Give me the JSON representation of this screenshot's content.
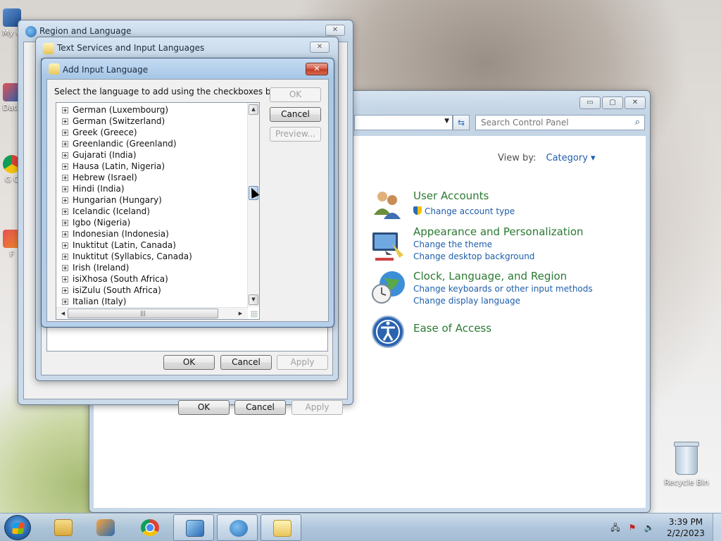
{
  "desktop": {
    "icons": [
      {
        "label": "My C"
      },
      {
        "label": "Data"
      },
      {
        "label": "G\nC"
      },
      {
        "label": "F"
      }
    ],
    "recycle_bin": "Recycle Bin"
  },
  "control_panel": {
    "buttons": {
      "minimize": "▭",
      "maximize": "▢",
      "close": "✕"
    },
    "search_placeholder": "Search Control Panel",
    "view_by_label": "View by:",
    "view_by_value": "Category ▾",
    "categories": [
      {
        "heading": "User Accounts",
        "links": [
          "Change account type"
        ],
        "icon": "users-icon"
      },
      {
        "heading": "Appearance and Personalization",
        "links": [
          "Change the theme",
          "Change desktop background"
        ],
        "icon": "display-icon"
      },
      {
        "heading": "Clock, Language, and Region",
        "links": [
          "Change keyboards or other input methods",
          "Change display language"
        ],
        "icon": "clock-globe-icon"
      },
      {
        "heading": "Ease of Access",
        "links": [],
        "icon": "ease-of-access-icon"
      }
    ],
    "colors": {
      "heading": "#2a7a32",
      "link": "#1e5eaa"
    }
  },
  "region_language": {
    "title": "Region and Language",
    "buttons": {
      "ok": "OK",
      "cancel": "Cancel",
      "apply": "Apply"
    }
  },
  "text_services": {
    "title": "Text Services and Input Languages",
    "buttons": {
      "ok": "OK",
      "cancel": "Cancel",
      "apply": "Apply"
    }
  },
  "add_input_language": {
    "title": "Add Input Language",
    "prompt": "Select the language to add using the checkboxes below.",
    "buttons": {
      "ok": "OK",
      "cancel": "Cancel",
      "preview": "Preview..."
    },
    "languages": [
      "German (Luxembourg)",
      "German (Switzerland)",
      "Greek (Greece)",
      "Greenlandic (Greenland)",
      "Gujarati (India)",
      "Hausa (Latin, Nigeria)",
      "Hebrew (Israel)",
      "Hindi (India)",
      "Hungarian (Hungary)",
      "Icelandic (Iceland)",
      "Igbo (Nigeria)",
      "Indonesian (Indonesia)",
      "Inuktitut (Latin, Canada)",
      "Inuktitut (Syllabics, Canada)",
      "Irish (Ireland)",
      "isiXhosa (South Africa)",
      "isiZulu (South Africa)",
      "Italian (Italy)"
    ]
  },
  "taskbar": {
    "time": "3:39 PM",
    "date": "2/2/2023",
    "pinned": [
      {
        "name": "explorer",
        "icon": "folder-icon"
      },
      {
        "name": "media-player",
        "icon": "media-player-icon"
      },
      {
        "name": "chrome",
        "icon": "chrome-icon"
      },
      {
        "name": "control-panel",
        "icon": "control-panel-icon"
      },
      {
        "name": "region-language",
        "icon": "globe-clock-icon"
      },
      {
        "name": "text-services",
        "icon": "keyboard-icon"
      }
    ]
  }
}
